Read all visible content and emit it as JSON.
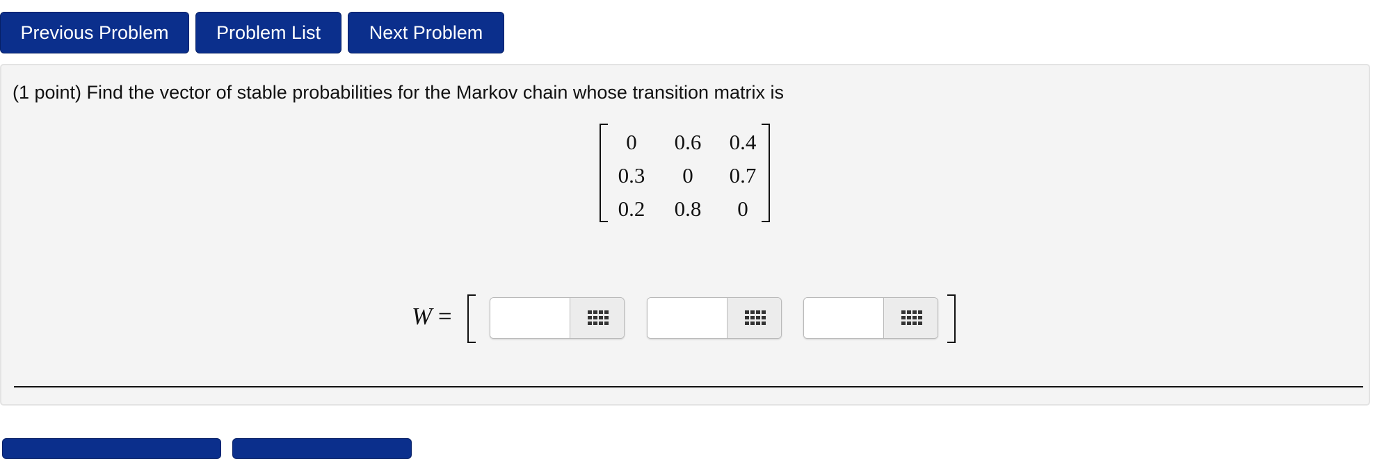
{
  "nav": {
    "previous_label": "Previous Problem",
    "list_label": "Problem List",
    "next_label": "Next Problem"
  },
  "problem": {
    "prompt": "(1 point) Find the vector of stable probabilities for the Markov chain whose transition matrix is",
    "matrix": [
      [
        "0",
        "0.6",
        "0.4"
      ],
      [
        "0.3",
        "0",
        "0.7"
      ],
      [
        "0.2",
        "0.8",
        "0"
      ]
    ],
    "answer_label": "W",
    "equals": "=",
    "answers": [
      {
        "value": "",
        "tool_icon": "matrix-grid-icon"
      },
      {
        "value": "",
        "tool_icon": "matrix-grid-icon"
      },
      {
        "value": "",
        "tool_icon": "matrix-grid-icon"
      }
    ]
  },
  "colors": {
    "button_bg": "#0b2f8c",
    "panel_bg": "#f4f4f4"
  }
}
